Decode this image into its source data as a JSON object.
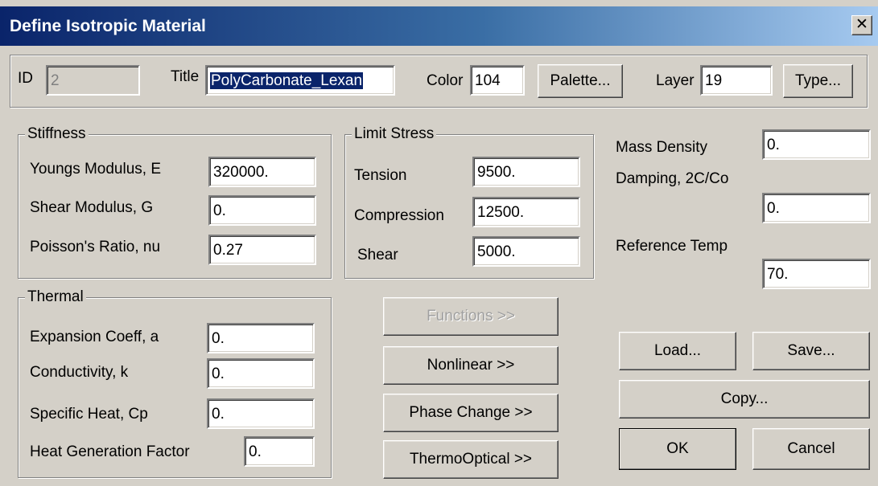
{
  "window": {
    "title": "Define Isotropic Material",
    "close_glyph": "✕"
  },
  "header": {
    "id_label": "ID",
    "id_value": "2",
    "title_label": "Title",
    "title_value": "PolyCarbonate_Lexan",
    "color_label": "Color",
    "color_value": "104",
    "palette_button": "Palette...",
    "layer_label": "Layer",
    "layer_value": "19",
    "type_button": "Type..."
  },
  "stiffness": {
    "legend": "Stiffness",
    "youngs_label": "Youngs Modulus, E",
    "youngs_value": "320000.",
    "shear_label": "Shear Modulus, G",
    "shear_value": "0.",
    "poisson_label": "Poisson's Ratio, nu",
    "poisson_value": "0.27"
  },
  "limit_stress": {
    "legend": "Limit Stress",
    "tension_label": "Tension",
    "tension_value": "9500.",
    "compression_label": "Compression",
    "compression_value": "12500.",
    "shear_label": "Shear",
    "shear_value": "5000."
  },
  "right_panel": {
    "mass_density_label": "Mass Density",
    "mass_density_value": "0.",
    "damping_label": "Damping, 2C/Co",
    "damping_value": "0.",
    "ref_temp_label": "Reference Temp",
    "ref_temp_value": "70."
  },
  "thermal": {
    "legend": "Thermal",
    "expansion_label": "Expansion Coeff, a",
    "expansion_value": "0.",
    "conductivity_label": "Conductivity, k",
    "conductivity_value": "0.",
    "specific_heat_label": "Specific Heat, Cp",
    "specific_heat_value": "0.",
    "heat_gen_label": "Heat Generation Factor",
    "heat_gen_value": "0."
  },
  "buttons": {
    "functions": "Functions >>",
    "nonlinear": "Nonlinear >>",
    "phase_change": "Phase Change >>",
    "thermo_optical": "ThermoOptical >>",
    "load": "Load...",
    "save": "Save...",
    "copy": "Copy...",
    "ok": "OK",
    "cancel": "Cancel"
  },
  "colors": {
    "title_start": "#0a246a",
    "title_end": "#a6caf0",
    "face": "#d4d0c8",
    "selection": "#0a246a"
  }
}
